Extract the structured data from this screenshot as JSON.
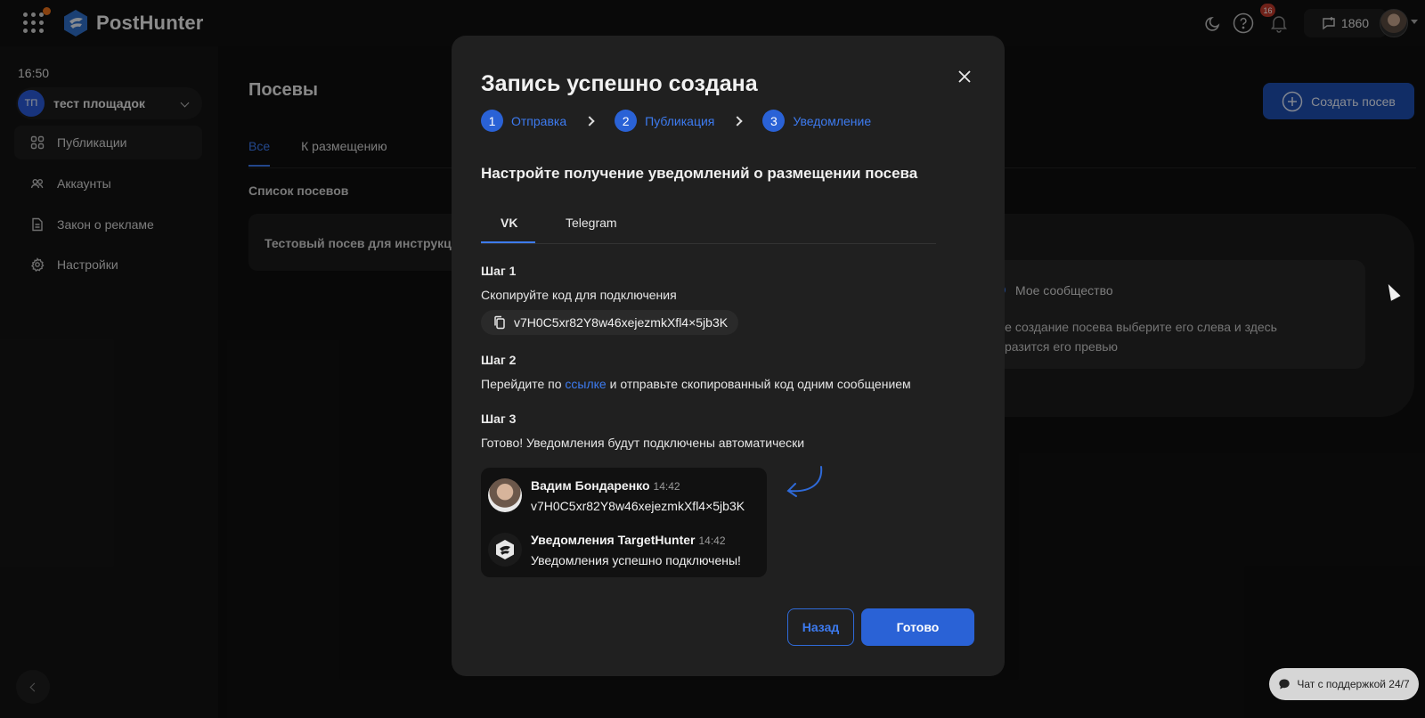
{
  "app": {
    "name": "PostHunter"
  },
  "topbar": {
    "notifications_count": "16",
    "balance": "1860"
  },
  "sidebar": {
    "time": "16:50",
    "workspace": {
      "initials": "ТП",
      "name": "тест площадок"
    },
    "items": [
      {
        "label": "Публикации",
        "icon": "grid-icon"
      },
      {
        "label": "Аккаунты",
        "icon": "users-icon"
      },
      {
        "label": "Закон о рекламе",
        "icon": "document-icon"
      },
      {
        "label": "Настройки",
        "icon": "gear-icon"
      }
    ]
  },
  "page": {
    "title": "Посевы",
    "create_button": "Создать посев",
    "tabs": [
      "Все",
      "К размещению"
    ],
    "list_title": "Список посевов",
    "card_title": "Тестовый посев для инструкции",
    "preview": {
      "community": "Мое сообщество",
      "text_line1": "ле создание посева выберите его слева и здесь",
      "text_line2": "бразится его превью"
    }
  },
  "modal": {
    "title": "Запись успешно создана",
    "steps": [
      {
        "num": "1",
        "label": "Отправка"
      },
      {
        "num": "2",
        "label": "Публикация"
      },
      {
        "num": "3",
        "label": "Уведомление"
      }
    ],
    "subtitle": "Настройте получение уведомлений о размещении посева",
    "tabs": [
      "VK",
      "Telegram"
    ],
    "step1": {
      "heading": "Шаг 1",
      "text": "Скопируйте код для подключения",
      "code": "v7H0C5xr82Y8w46xejezmkXfl4×5jb3K"
    },
    "step2": {
      "heading": "Шаг 2",
      "prefix": "Перейдите по",
      "link": "ссылке",
      "suffix": "и отправьте скопированный код одним сообщением"
    },
    "step3": {
      "heading": "Шаг 3",
      "text": "Готово! Уведомления будут подключены автоматически"
    },
    "chat": [
      {
        "name": "Вадим Бондаренко",
        "time": "14:42",
        "message": "v7H0C5xr82Y8w46xejezmkXfl4×5jb3K"
      },
      {
        "name": "Уведомления TargetHunter",
        "time": "14:42",
        "message": "Уведомления успешно подключены!"
      }
    ],
    "back_button": "Назад",
    "done_button": "Готово"
  },
  "support": {
    "label": "Чат с поддержкой 24/7"
  },
  "colors": {
    "accent": "#2a62d6",
    "link": "#3d7bf0",
    "modal_bg": "#202020"
  }
}
